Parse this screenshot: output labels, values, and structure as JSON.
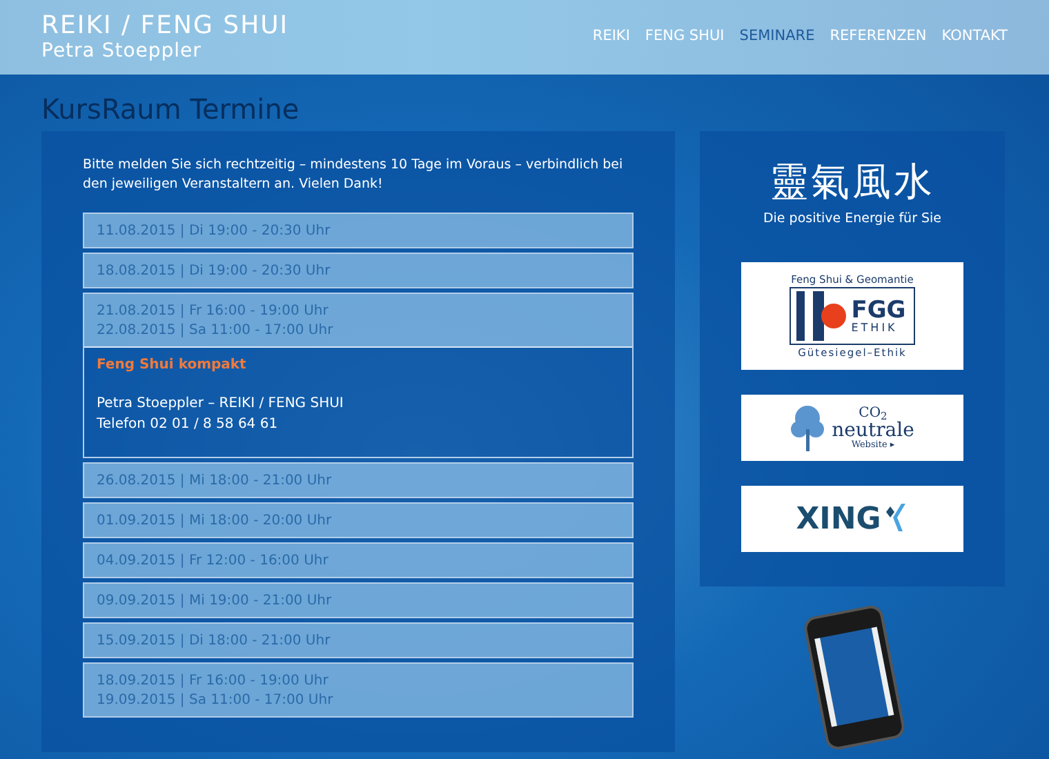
{
  "header": {
    "title": "REIKI / FENG SHUI",
    "subtitle": "Petra Stoeppler"
  },
  "nav": [
    {
      "label": "REIKI",
      "selected": false
    },
    {
      "label": "FENG SHUI",
      "selected": false
    },
    {
      "label": "SEMINARE",
      "selected": true
    },
    {
      "label": "REFERENZEN",
      "selected": false
    },
    {
      "label": "KONTAKT",
      "selected": false
    }
  ],
  "page_title": "KursRaum Termine",
  "intro": "Bitte melden Sie sich rechtzeitig – mindestens 10 Tage im Voraus – verbindlich bei den jeweiligen Veranstaltern an. Vielen Dank!",
  "events": [
    {
      "dates": [
        "11.08.2015 | Di 19:00 - 20:30 Uhr"
      ],
      "expanded": false
    },
    {
      "dates": [
        "18.08.2015 | Di 19:00 - 20:30 Uhr"
      ],
      "expanded": false
    },
    {
      "dates": [
        "21.08.2015 | Fr 16:00 - 19:00 Uhr",
        "22.08.2015 | Sa 11:00 - 17:00 Uhr"
      ],
      "expanded": true,
      "detail": {
        "title": "Feng Shui kompakt",
        "lines": [
          "Petra Stoeppler – REIKI / FENG SHUI",
          "Telefon 02 01 / 8 58 64 61"
        ]
      }
    },
    {
      "dates": [
        "26.08.2015 | Mi 18:00 - 21:00 Uhr"
      ],
      "expanded": false
    },
    {
      "dates": [
        "01.09.2015 | Mi 18:00 - 20:00 Uhr"
      ],
      "expanded": false
    },
    {
      "dates": [
        "04.09.2015 | Fr 12:00 - 16:00 Uhr"
      ],
      "expanded": false
    },
    {
      "dates": [
        "09.09.2015 | Mi 19:00 - 21:00 Uhr"
      ],
      "expanded": false
    },
    {
      "dates": [
        "15.09.2015 | Di 18:00 - 21:00 Uhr"
      ],
      "expanded": false
    },
    {
      "dates": [
        "18.09.2015 | Fr 16:00 - 19:00 Uhr",
        "19.09.2015 | Sa 11:00 - 17:00 Uhr"
      ],
      "expanded": false
    }
  ],
  "sidebar": {
    "chinese_title": "靈氣風水",
    "tagline": "Die positive Energie für Sie",
    "logos": [
      {
        "kind": "fgg",
        "top": "Feng Shui & Geomantie",
        "name": "FGG",
        "sub": "ETHIK",
        "bottom": "Gütesiegel–Ethik"
      },
      {
        "kind": "co2",
        "top": "CO$_{2}$",
        "name": "neutrale",
        "sub": "Website ▸"
      },
      {
        "kind": "xing",
        "name": "XING"
      }
    ]
  }
}
